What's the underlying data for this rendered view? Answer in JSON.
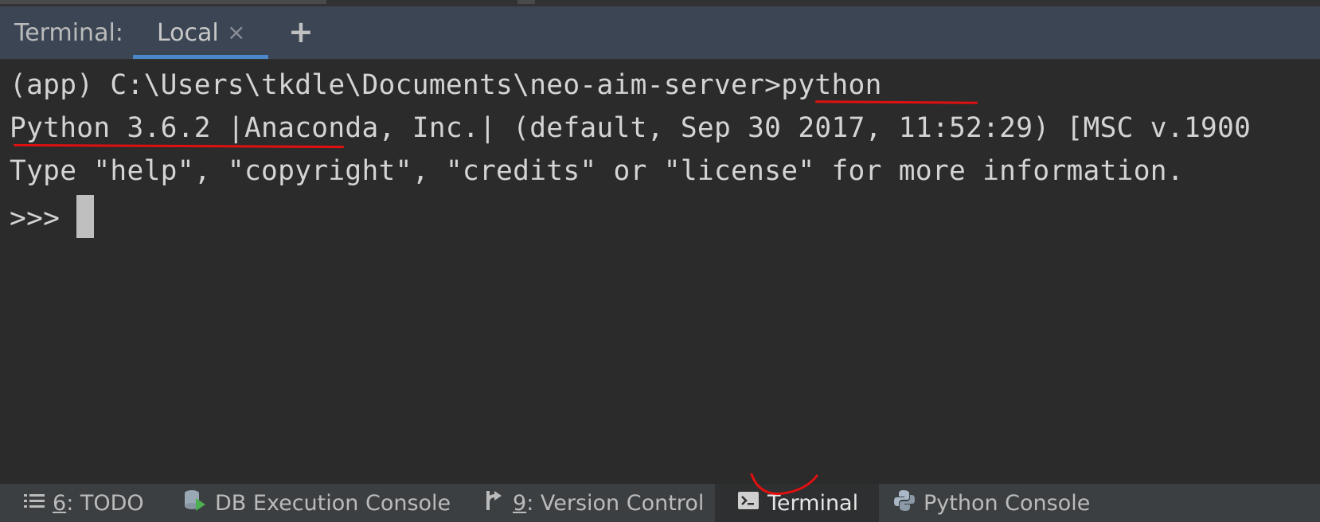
{
  "header": {
    "title": "Terminal:",
    "tabs": [
      {
        "label": "Local",
        "close_glyph": "×",
        "active": true
      }
    ],
    "add_glyph": "+"
  },
  "terminal": {
    "prompt_line": "(app) C:\\Users\\tkdle\\Documents\\neo-aim-server>python",
    "version_line": "Python 3.6.2 |Anaconda, Inc.| (default, Sep 30 2017, 11:52:29) [MSC v.1900",
    "info_line": "Type \"help\", \"copyright\", \"credits\" or \"license\" for more information.",
    "repl_prompt": ">>> "
  },
  "bottom_bar": {
    "items": [
      {
        "num": "6",
        "label": ": TODO",
        "icon": "list-icon"
      },
      {
        "num": "",
        "label": "DB Execution Console",
        "icon": "db-console-icon"
      },
      {
        "num": "9",
        "label": ": Version Control",
        "icon": "vcs-branch-icon"
      },
      {
        "num": "",
        "label": "Terminal",
        "icon": "terminal-icon",
        "active": true
      },
      {
        "num": "",
        "label": "Python Console",
        "icon": "python-icon"
      }
    ]
  },
  "colors": {
    "background": "#2b2b2b",
    "header": "#3c4553",
    "accent": "#4a88c7",
    "annotation": "#e01010"
  }
}
